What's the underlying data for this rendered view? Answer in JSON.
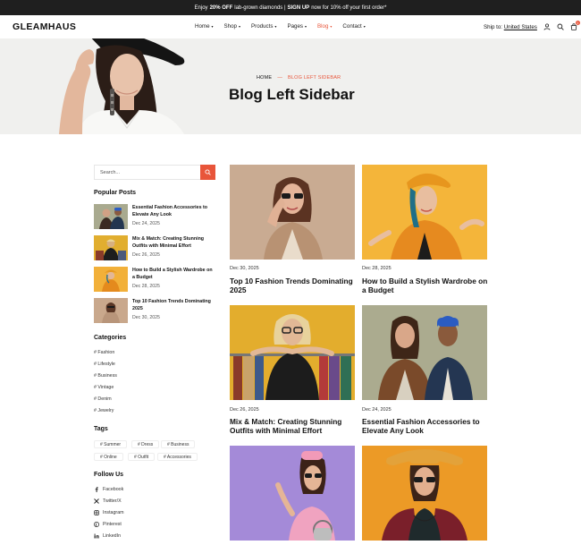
{
  "announcement": {
    "prefix": "Enjoy",
    "highlight": "20% OFF",
    "middle": "lab-grown diamonds |",
    "cta": "SIGN UP",
    "suffix": "now for 10% off your first order*"
  },
  "header": {
    "logo": "GLEAMHAUS",
    "nav": [
      {
        "label": "Home",
        "caret": "▾",
        "active": false
      },
      {
        "label": "Shop",
        "caret": "▾",
        "active": false
      },
      {
        "label": "Products",
        "caret": "▾",
        "active": false
      },
      {
        "label": "Pages",
        "caret": "▾",
        "active": false
      },
      {
        "label": "Blog",
        "caret": "▾",
        "active": true
      },
      {
        "label": "Contact",
        "caret": "▾",
        "active": false
      }
    ],
    "ship_to_label": "Ship to:",
    "ship_to_country": "United States",
    "cart_count": "0"
  },
  "hero": {
    "breadcrumb_home": "HOME",
    "breadcrumb_separator": "—",
    "breadcrumb_current": "BLOG LEFT SIDEBAR",
    "title": "Blog Left Sidebar"
  },
  "sidebar": {
    "search": {
      "placeholder": "Search..."
    },
    "popular_heading": "Popular Posts",
    "popular_posts": [
      {
        "title": "Essential Fashion Accessories to Elevate Any Look",
        "date": "Dec 24, 2025"
      },
      {
        "title": "Mix & Match: Creating Stunning Outfits with Minimal Effort",
        "date": "Dec 26, 2025"
      },
      {
        "title": "How to Build a Stylish Wardrobe on a Budget",
        "date": "Dec 28, 2025"
      },
      {
        "title": "Top 10 Fashion Trends Dominating 2025",
        "date": "Dec 30, 2025"
      }
    ],
    "categories_heading": "Categories",
    "categories": [
      "# Fashion",
      "# Lifestyle",
      "# Business",
      "# Vintage",
      "# Denim",
      "# Jewelry"
    ],
    "tags_heading": "Tags",
    "tags": [
      "# Summer",
      "# Dress",
      "# Business",
      "# Online",
      "# Outfit",
      "# Accessories"
    ],
    "follow_heading": "Follow Us",
    "follow": [
      {
        "label": "Facebook",
        "icon": "facebook-icon"
      },
      {
        "label": "Twitter/X",
        "icon": "x-twitter-icon"
      },
      {
        "label": "Instagram",
        "icon": "instagram-icon"
      },
      {
        "label": "Pinterest",
        "icon": "pinterest-icon"
      },
      {
        "label": "LinkedIn",
        "icon": "linkedin-icon"
      }
    ]
  },
  "posts": [
    {
      "date": "Dec 30, 2025",
      "title": "Top 10 Fashion Trends Dominating 2025"
    },
    {
      "date": "Dec 28, 2025",
      "title": "How to Build a Stylish Wardrobe on a Budget"
    },
    {
      "date": "Dec 26, 2025",
      "title": "Mix & Match: Creating Stunning Outfits with Minimal Effort"
    },
    {
      "date": "Dec 24, 2025",
      "title": "Essential Fashion Accessories to Elevate Any Look"
    },
    {
      "date": "",
      "title": ""
    },
    {
      "date": "",
      "title": ""
    }
  ],
  "colors": {
    "accent": "#e8553a",
    "topbar": "#1f1f1f",
    "hero_bg": "#f0f0ee"
  }
}
